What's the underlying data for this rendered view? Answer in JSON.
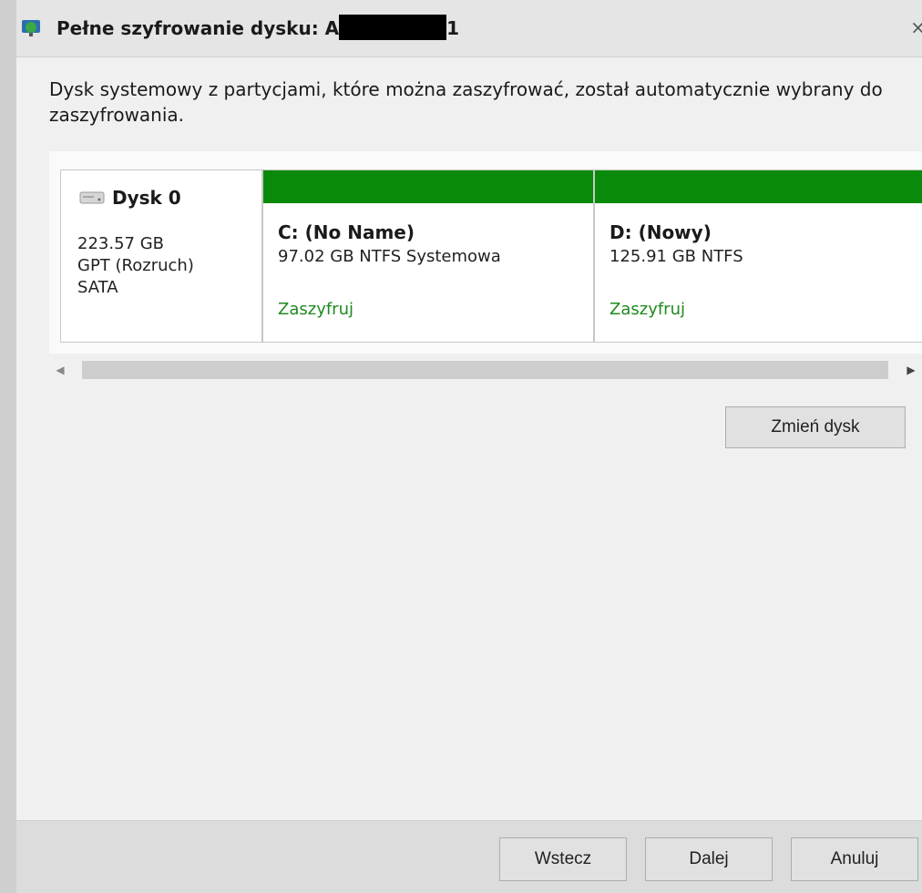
{
  "window": {
    "title_prefix": "Pełne szyfrowanie dysku: A",
    "title_suffix": "1",
    "icon": "app-shield-icon"
  },
  "description": "Dysk systemowy z partycjami, które można zaszyfrować, został automatycznie wybrany do zaszyfrowania.",
  "disk": {
    "icon": "hard-drive-icon",
    "name": "Dysk 0",
    "size": "223.57 GB",
    "partition_style": "GPT (Rozruch)",
    "bus": "SATA"
  },
  "partitions": [
    {
      "name": "C: (No Name)",
      "detail": "97.02 GB NTFS Systemowa",
      "action": "Zaszyfruj",
      "bar_color": "#0a8a0a"
    },
    {
      "name": "D: (Nowy)",
      "detail": "125.91 GB NTFS",
      "action": "Zaszyfruj",
      "bar_color": "#0a8a0a"
    }
  ],
  "buttons": {
    "change_disk": "Zmień dysk",
    "back": "Wstecz",
    "next": "Dalej",
    "cancel": "Anuluj"
  },
  "colors": {
    "accent_green": "#0a8a0a",
    "link_green": "#1f8a1f"
  }
}
